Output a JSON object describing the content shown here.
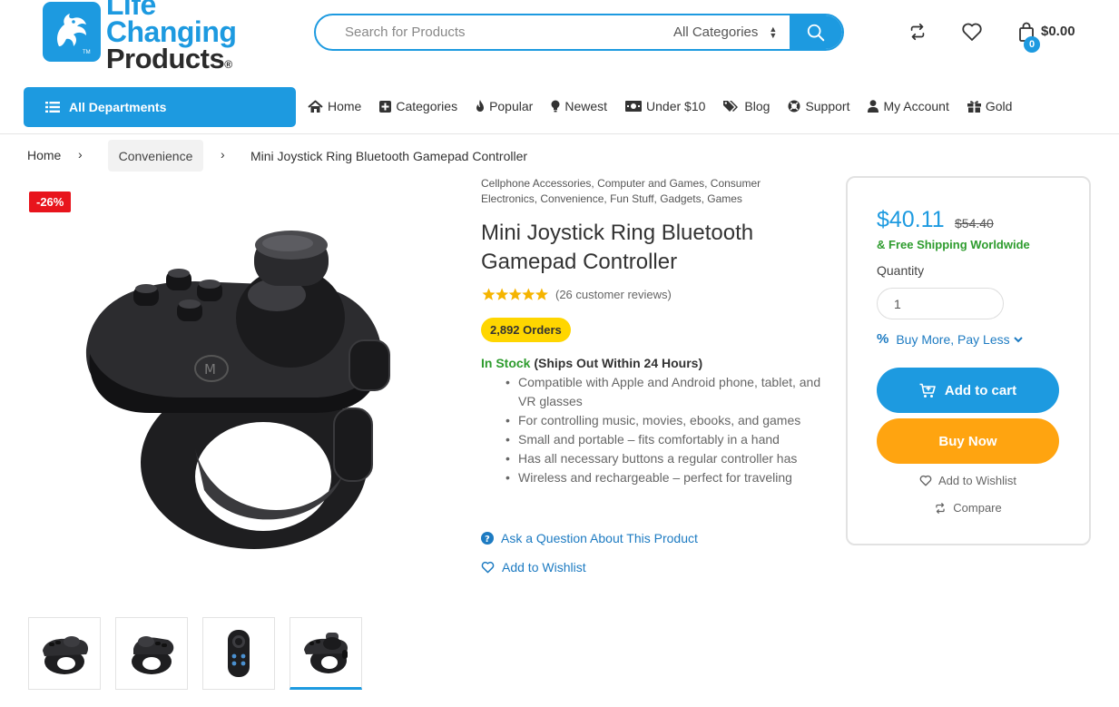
{
  "brand": {
    "line1": "Life Changing",
    "line2": "Products",
    "mark": "®",
    "tm": "TM"
  },
  "search": {
    "placeholder": "Search for Products",
    "category": "All Categories"
  },
  "header": {
    "cart_count": "0",
    "cart_total": "$0.00",
    "icons": [
      "compare-icon",
      "heart-icon",
      "shopping-bag-icon"
    ]
  },
  "nav": {
    "departments": "All Departments",
    "items": [
      {
        "label": "Home",
        "icon": "home-icon"
      },
      {
        "label": "Categories",
        "icon": "plus-square-icon"
      },
      {
        "label": "Popular",
        "icon": "fire-icon"
      },
      {
        "label": "Newest",
        "icon": "lightbulb-icon"
      },
      {
        "label": "Under $10",
        "icon": "money-icon"
      },
      {
        "label": "Blog",
        "icon": "tags-icon"
      },
      {
        "label": "Support",
        "icon": "life-ring-icon"
      },
      {
        "label": "My Account",
        "icon": "user-icon"
      },
      {
        "label": "Gold",
        "icon": "gift-icon"
      }
    ]
  },
  "breadcrumb": {
    "home": "Home",
    "category": "Convenience",
    "current": "Mini Joystick Ring Bluetooth Gamepad Controller"
  },
  "product": {
    "discount": "-26%",
    "categories": "Cellphone Accessories, Computer and Games, Consumer Electronics, Convenience, Fun Stuff, Gadgets, Games",
    "title": "Mini Joystick Ring Bluetooth Gamepad Controller",
    "rating": 5,
    "reviews": "(26 customer reviews)",
    "orders": "2,892 Orders",
    "stock": "In Stock",
    "stock_note": "(Ships Out Within 24 Hours)",
    "features": [
      "Compatible with Apple and Android phone, tablet, and VR glasses",
      "For controlling music, movies, ebooks, and games",
      "Small and portable – fits comfortably in a hand",
      "Has all necessary buttons a regular controller has",
      "Wireless and rechargeable – perfect for traveling"
    ],
    "ask_question": "Ask a Question About This Product",
    "add_wishlist": "Add to Wishlist",
    "thumbnails": 4,
    "active_thumbnail": 4
  },
  "buybox": {
    "price": "$40.11",
    "old_price": "$54.40",
    "shipping": "& Free Shipping Worldwide",
    "quantity_label": "Quantity",
    "quantity": "1",
    "buy_more": "Buy More, Pay Less",
    "add_to_cart": "Add to cart",
    "buy_now": "Buy Now",
    "wishlist": "Add to Wishlist",
    "compare": "Compare"
  },
  "colors": {
    "accent": "#1d9ae0",
    "sale": "#e8141c",
    "buy_now": "#ffa410",
    "orders_badge": "#ffd600",
    "in_stock": "#2e9c2e"
  }
}
